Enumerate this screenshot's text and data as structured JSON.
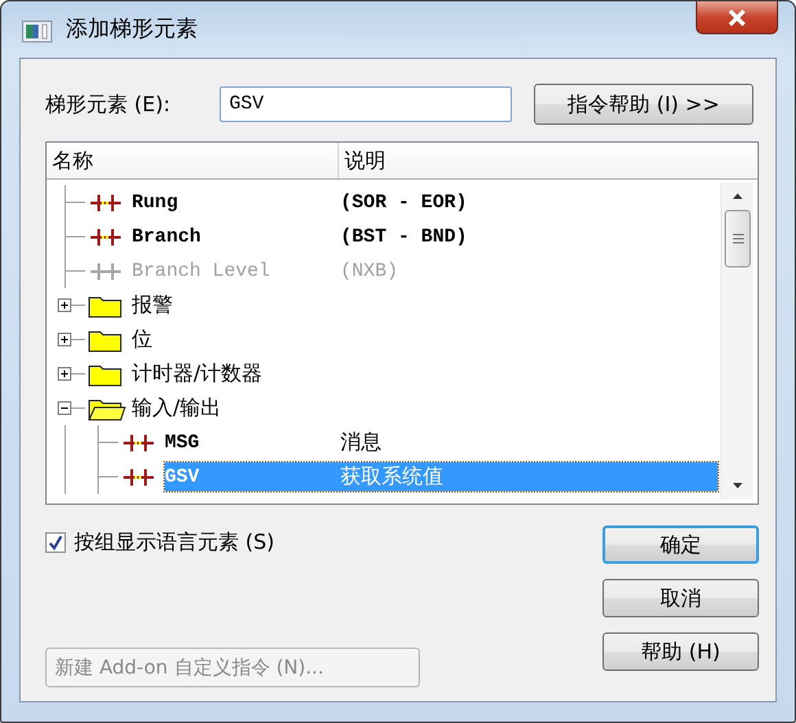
{
  "window": {
    "title": "添加梯形元素"
  },
  "element_field": {
    "label": "梯形元素 (E):",
    "value": "GSV"
  },
  "help_button": {
    "label": "指令帮助 (I) >>"
  },
  "list": {
    "columns": [
      "名称",
      "说明"
    ],
    "items": [
      {
        "kind": "instruction",
        "name": "Rung",
        "description": "(SOR - EOR)",
        "disabled": false,
        "selected": false
      },
      {
        "kind": "instruction",
        "name": "Branch",
        "description": "(BST - BND)",
        "disabled": false,
        "selected": false
      },
      {
        "kind": "instruction",
        "name": "Branch Level",
        "description": "(NXB)",
        "disabled": true,
        "selected": false
      },
      {
        "kind": "folder",
        "name": "报警",
        "expanded": false,
        "selected": false
      },
      {
        "kind": "folder",
        "name": "位",
        "expanded": false,
        "selected": false
      },
      {
        "kind": "folder",
        "name": "计时器/计数器",
        "expanded": false,
        "selected": false
      },
      {
        "kind": "folder",
        "name": "输入/输出",
        "expanded": true,
        "selected": false,
        "children": [
          {
            "kind": "instruction",
            "name": "MSG",
            "description": "消息",
            "disabled": false,
            "selected": false
          },
          {
            "kind": "instruction",
            "name": "GSV",
            "description": "获取系统值",
            "disabled": false,
            "selected": true
          }
        ]
      }
    ]
  },
  "group_checkbox": {
    "label": "按组显示语言元素 (S)",
    "checked": true
  },
  "buttons": [
    {
      "label": "确定",
      "default": true
    },
    {
      "label": "取消",
      "default": false
    },
    {
      "label": "帮助 (H)",
      "default": false
    }
  ],
  "addon_button": {
    "label": "新建 Add-on 自定义指令 (N)...",
    "disabled": true
  }
}
